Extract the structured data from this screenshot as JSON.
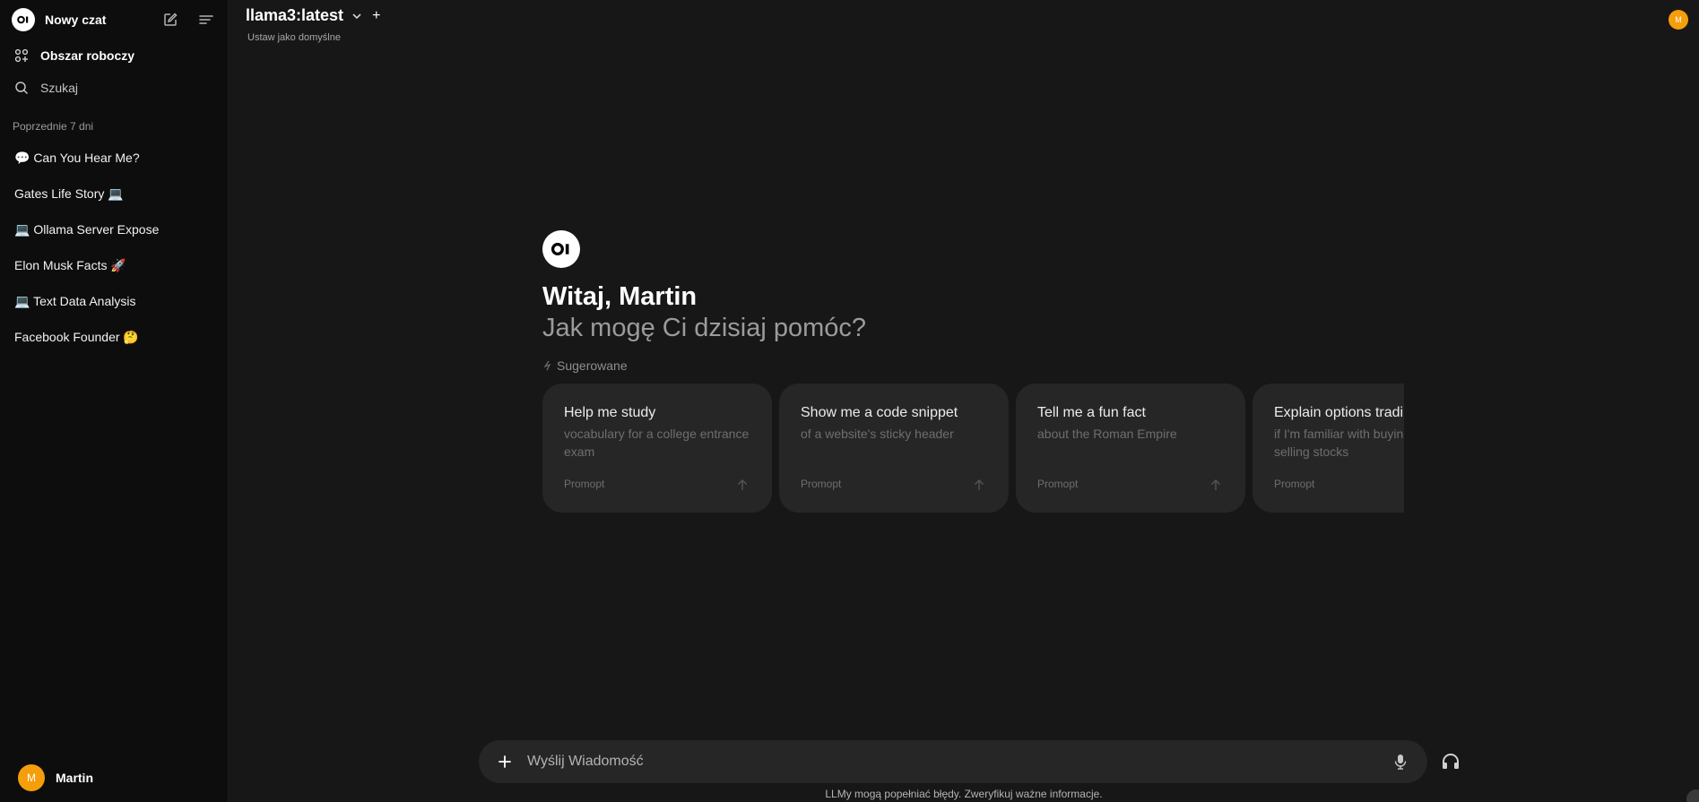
{
  "sidebar": {
    "new_chat_label": "Nowy czat",
    "workspace_label": "Obszar roboczy",
    "search_label": "Szukaj",
    "section_label": "Poprzednie 7 dni",
    "chats": [
      {
        "title": "💬 Can You Hear Me?"
      },
      {
        "title": "Gates Life Story 💻"
      },
      {
        "title": "💻 Ollama Server Expose"
      },
      {
        "title": "Elon Musk Facts 🚀"
      },
      {
        "title": "💻 Text Data Analysis"
      },
      {
        "title": "Facebook Founder 🤔"
      }
    ],
    "user": {
      "initial": "M",
      "name": "Martin"
    }
  },
  "header": {
    "model_name": "llama3:latest",
    "add_model": "+",
    "set_default_label": "Ustaw jako domyślne",
    "avatar_initial": "M"
  },
  "hero": {
    "greeting": "Witaj, Martin",
    "subtitle": "Jak mogę Ci dzisiaj pomóc?",
    "suggested_label": "Sugerowane"
  },
  "suggestions": [
    {
      "title": "Help me study",
      "subtitle": "vocabulary for a college entrance exam",
      "footer": "Promopt"
    },
    {
      "title": "Show me a code snippet",
      "subtitle": "of a website's sticky header",
      "footer": "Promopt"
    },
    {
      "title": "Tell me a fun fact",
      "subtitle": "about the Roman Empire",
      "footer": "Promopt"
    },
    {
      "title": "Explain options trading",
      "subtitle": "if I'm familiar with buying and selling stocks",
      "footer": "Promopt"
    }
  ],
  "composer": {
    "placeholder": "Wyślij Wiadomość",
    "value": ""
  },
  "footer": {
    "disclaimer": "LLMy mogą popełniać błędy. Zweryfikuj ważne informacje."
  },
  "colors": {
    "accent_avatar": "#f59e0b",
    "sidebar_bg": "#0d0d0d",
    "main_bg": "#171717",
    "card_bg": "#262626"
  }
}
